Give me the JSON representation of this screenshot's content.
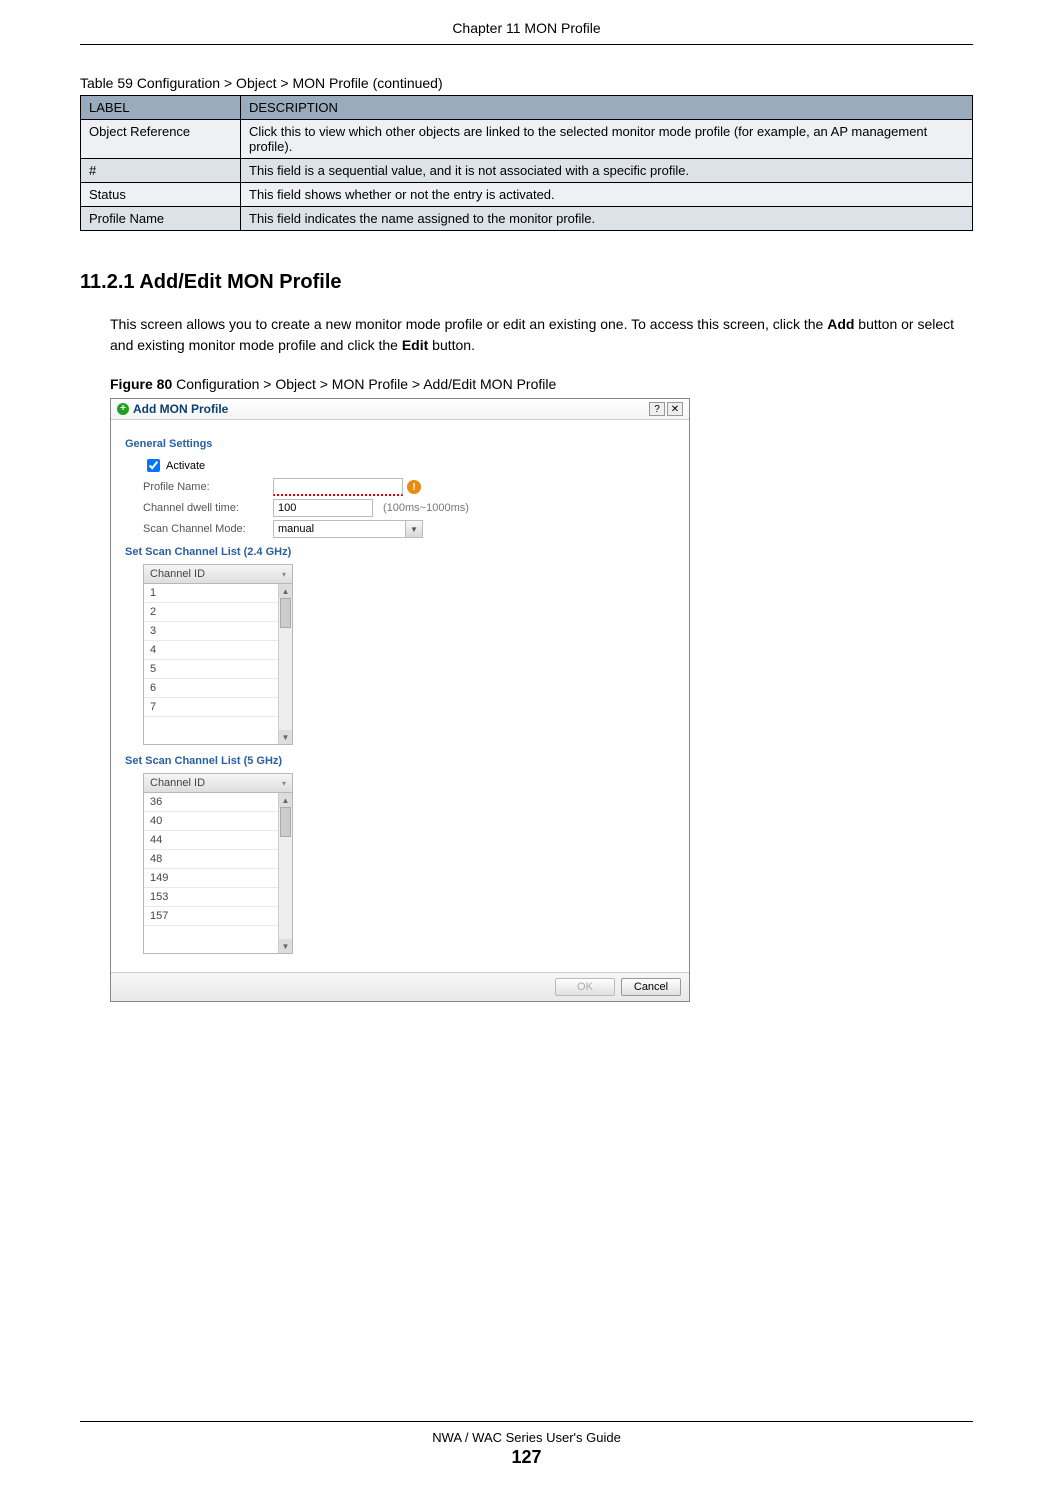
{
  "header": {
    "chapter": "Chapter 11 MON Profile"
  },
  "table": {
    "caption": "Table 59   Configuration > Object > MON Profile (continued)",
    "head": {
      "col1": "LABEL",
      "col2": "DESCRIPTION"
    },
    "rows": [
      {
        "label": "Object Reference",
        "desc": "Click this to view which other objects are linked to the selected monitor mode profile (for example, an AP management profile)."
      },
      {
        "label": "#",
        "desc": "This field is a sequential value, and it is not associated with a specific profile."
      },
      {
        "label": "Status",
        "desc": "This field shows whether or not the entry is activated."
      },
      {
        "label": "Profile Name",
        "desc": "This field indicates the name assigned to the monitor profile."
      }
    ]
  },
  "section": {
    "num_title": "11.2.1  Add/Edit MON Profile",
    "body": "This screen allows you to create a new monitor mode profile or edit an existing one. To access this screen, click the Add button or select and existing monitor mode profile and click the Edit button.",
    "bold_add": "Add",
    "bold_edit": "Edit"
  },
  "figure": {
    "caption_prefix": "Figure 80",
    "caption_rest": "   Configuration > Object > MON Profile > Add/Edit MON Profile"
  },
  "dialog": {
    "title": "Add MON Profile",
    "general_label": "General Settings",
    "activate_label": "Activate",
    "profile_name_label": "Profile Name:",
    "dwell_label": "Channel dwell time:",
    "dwell_value": "100",
    "dwell_hint": "(100ms~1000ms)",
    "scan_mode_label": "Scan Channel Mode:",
    "scan_mode_value": "manual",
    "list24_label": "Set Scan Channel List (2.4 GHz)",
    "list5_label": "Set Scan Channel List (5 GHz)",
    "grid_head": "Channel ID",
    "channels24": [
      "1",
      "2",
      "3",
      "4",
      "5",
      "6",
      "7"
    ],
    "channels5": [
      "36",
      "40",
      "44",
      "48",
      "149",
      "153",
      "157"
    ],
    "ok": "OK",
    "cancel": "Cancel"
  },
  "footer": {
    "guide": "NWA / WAC Series User's Guide",
    "page": "127"
  }
}
